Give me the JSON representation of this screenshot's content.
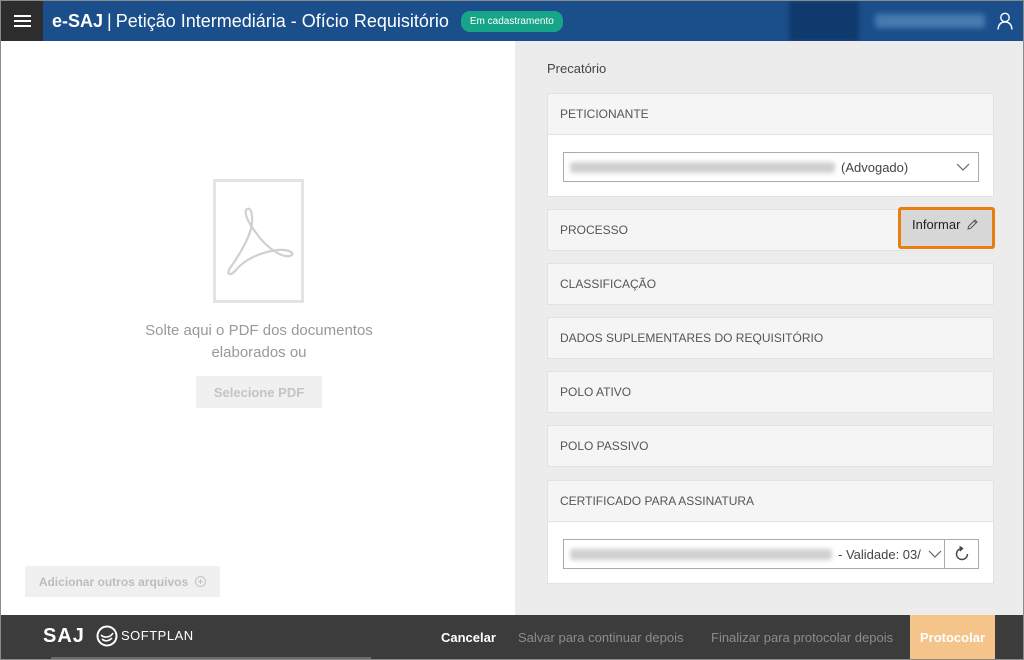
{
  "header": {
    "app_name": "e-SAJ",
    "separator": "|",
    "page_title": "Petição Intermediária - Ofício Requisitório",
    "status_badge": "Em cadastramento",
    "icons": {
      "menu": "hamburger-icon",
      "user": "user-icon"
    }
  },
  "left_pane": {
    "drop_text": "Solte aqui o PDF dos documentos elaborados ou",
    "select_pdf_label": "Selecione PDF",
    "add_files_label": "Adicionar outros arquivos",
    "icons": {
      "pdf": "pdf-file-icon",
      "add": "plus-circle-icon"
    }
  },
  "right_pane": {
    "title": "Precatório",
    "sections": {
      "peticionante": {
        "label": "PETICIONANTE",
        "selected_suffix": "(Advogado)"
      },
      "processo": {
        "label": "PROCESSO",
        "action_label": "Informar"
      },
      "classificacao": {
        "label": "CLASSIFICAÇÃO"
      },
      "dados_suplementares": {
        "label": "DADOS SUPLEMENTARES DO REQUISITÓRIO"
      },
      "polo_ativo": {
        "label": "POLO ATIVO"
      },
      "polo_passivo": {
        "label": "POLO PASSIVO"
      },
      "certificado": {
        "label": "CERTIFICADO PARA ASSINATURA",
        "selected_suffix": "- Validade: 03/"
      }
    }
  },
  "footer": {
    "logo_text": "SAJ",
    "brand_text": "SOFTPLAN",
    "cancel_label": "Cancelar",
    "save_label": "Salvar para continuar depois",
    "finish_label": "Finalizar para protocolar depois",
    "protocol_label": "Protocolar"
  },
  "colors": {
    "header_bg": "#1a4f8b",
    "badge_bg": "#17a589",
    "highlight_border": "#e87e12",
    "protocol_bg": "#f5c48a",
    "footer_bg": "#3c3c3c"
  }
}
